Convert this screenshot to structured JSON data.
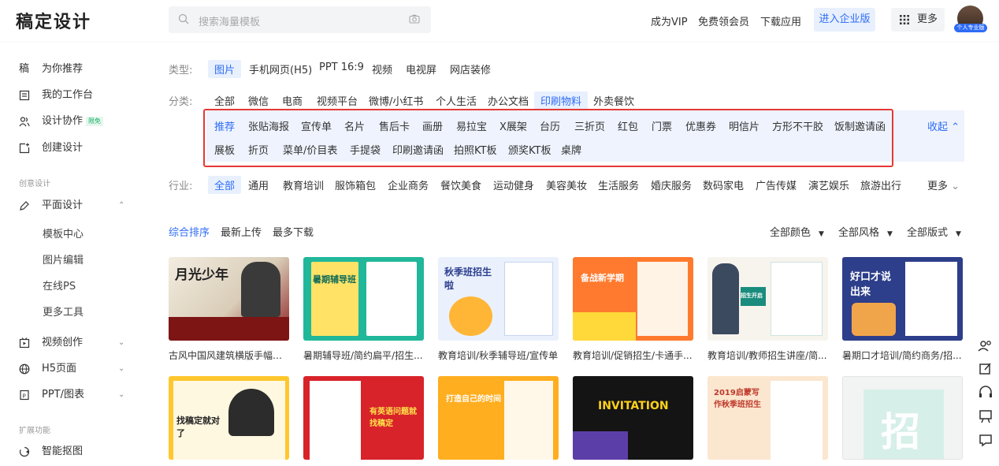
{
  "header": {
    "logo": "稿定设计",
    "search_placeholder": "搜索海量模板",
    "links": [
      "成为VIP",
      "免费领会员",
      "下载应用"
    ],
    "enterprise": "进入企业版",
    "more": "更多",
    "avatar_badge": "个人专业版"
  },
  "sidebar": {
    "items": [
      {
        "icon": "gao-icon",
        "label": "为你推荐"
      },
      {
        "icon": "workbench-icon",
        "label": "我的工作台"
      },
      {
        "icon": "collab-icon",
        "label": "设计协作",
        "badge": "限免"
      },
      {
        "icon": "create-icon",
        "label": "创建设计"
      }
    ],
    "section1": "创意设计",
    "graphic": "平面设计",
    "graphic_sub": [
      "模板中心",
      "图片编辑",
      "在线PS",
      "更多工具"
    ],
    "video": "视频创作",
    "h5": "H5页面",
    "ppt": "PPT/图表",
    "section2": "扩展功能",
    "cutout": "智能抠图"
  },
  "filters": {
    "type_label": "类型:",
    "types": [
      "图片",
      "手机网页(H5)",
      "PPT 16:9",
      "视频",
      "电视屏",
      "网店装修"
    ],
    "cat_label": "分类:",
    "cats": [
      "全部",
      "微信",
      "电商",
      "视频平台",
      "微博/小红书",
      "个人生活",
      "办公文档",
      "印刷物料",
      "外卖餐饮"
    ],
    "sub_row1": [
      "推荐",
      "张贴海报",
      "宣传单",
      "名片",
      "售后卡",
      "画册",
      "易拉宝",
      "X展架",
      "台历",
      "三折页",
      "红包",
      "门票",
      "优惠券",
      "明信片",
      "方形不干胶",
      "饭制邀请函"
    ],
    "sub_row2": [
      "展板",
      "折页",
      "菜单/价目表",
      "手提袋",
      "印刷邀请函",
      "拍照KT板",
      "颁奖KT板",
      "桌牌"
    ],
    "collapse": "收起",
    "ind_label": "行业:",
    "industries": [
      "全部",
      "通用",
      "教育培训",
      "服饰箱包",
      "企业商务",
      "餐饮美食",
      "运动健身",
      "美容美妆",
      "生活服务",
      "婚庆服务",
      "数码家电",
      "广告传媒",
      "演艺娱乐",
      "旅游出行"
    ],
    "ind_more": "更多"
  },
  "sort": {
    "tabs": [
      "综合排序",
      "最新上传",
      "最多下载"
    ],
    "selects": [
      "全部颜色",
      "全部风格",
      "全部版式"
    ]
  },
  "cards_row1": [
    {
      "caption": "古风中国风建筑横版手幅明...",
      "art": "月光少年"
    },
    {
      "caption": "暑期辅导班/简约扁平/招生...",
      "art": "暑期辅导班"
    },
    {
      "caption": "教育培训/秋季辅导班/宣传单",
      "art": "秋季班招生啦"
    },
    {
      "caption": "教育培训/促销招生/卡通手...",
      "art": "备战新学期"
    },
    {
      "caption": "教育培训/教师招生讲座/简...",
      "art": "招生开启"
    },
    {
      "caption": "暑期口才培训/简约商务/招...",
      "art": "好口才说出来"
    }
  ],
  "cards_row2": [
    {
      "art": "找稿定就对了"
    },
    {
      "art": "有英语问题就找稿定"
    },
    {
      "art": "打造自己的时间"
    },
    {
      "art": "INVITATION"
    },
    {
      "art": "2019启蒙写作秋季班招生"
    },
    {
      "art": "招"
    }
  ]
}
